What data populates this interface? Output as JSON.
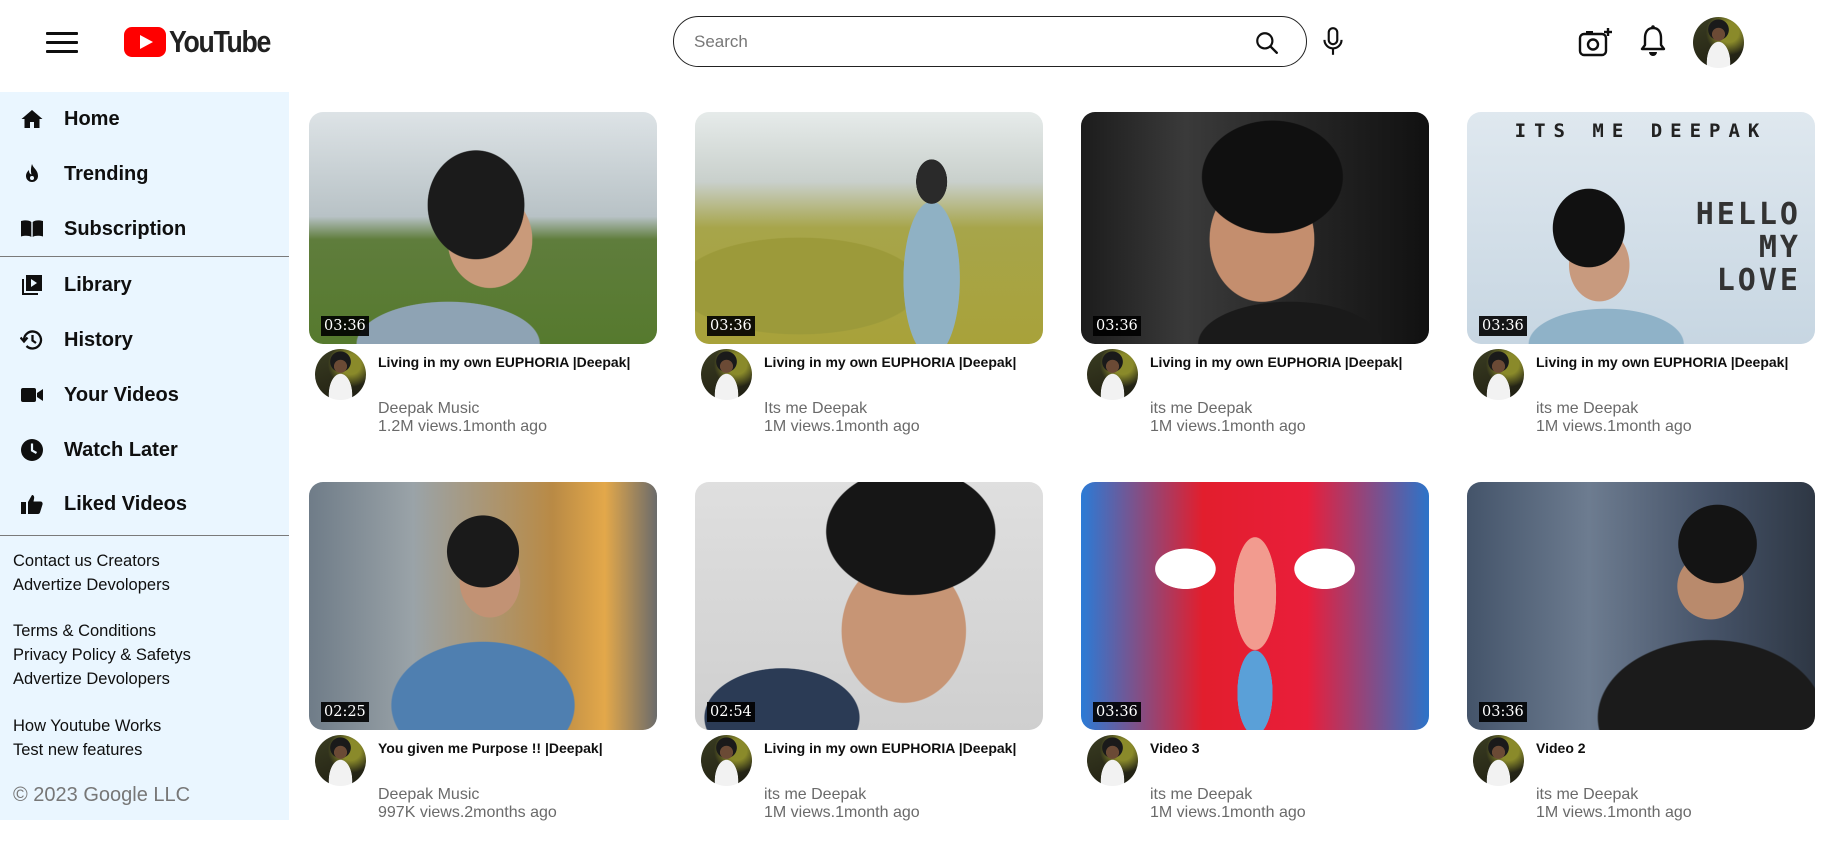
{
  "header": {
    "logo_text": "YouTube",
    "search_placeholder": "Search"
  },
  "sidebar": {
    "items": [
      {
        "label": "Home",
        "icon": "home-icon"
      },
      {
        "label": "Trending",
        "icon": "fire-icon"
      },
      {
        "label": "Subscription",
        "icon": "book-icon"
      },
      {
        "label": "Library",
        "icon": "library-icon"
      },
      {
        "label": "History",
        "icon": "history-icon"
      },
      {
        "label": "Your Videos",
        "icon": "video-camera-icon"
      },
      {
        "label": "Watch Later",
        "icon": "clock-icon"
      },
      {
        "label": "Liked Videos",
        "icon": "thumbs-up-icon"
      }
    ],
    "footer": {
      "line1": [
        "Contact us",
        "Creators"
      ],
      "line2": [
        "Advertize",
        "Devolopers"
      ],
      "line3": "Terms & Conditions",
      "line4": "Privacy Policy & Safetys",
      "line5": [
        "Advertize",
        "Devolopers"
      ],
      "line6": "How Youtube Works",
      "line7": "Test new features",
      "copyright": "© 2023 Google LLC"
    }
  },
  "videos": [
    {
      "title": "Living in my own EUPHORIA |Deepak|",
      "channel": "Deepak Music",
      "meta": "1.2M views.1month ago",
      "duration": "03:36"
    },
    {
      "title": "Living in my own EUPHORIA |Deepak|",
      "channel": "Its me Deepak",
      "meta": "1M views.1month ago",
      "duration": "03:36"
    },
    {
      "title": "Living in my own EUPHORIA |Deepak|",
      "channel": "its me Deepak",
      "meta": "1M views.1month ago",
      "duration": "03:36"
    },
    {
      "title": "Living in my own EUPHORIA |Deepak|",
      "channel": "its me Deepak",
      "meta": "1M views.1month ago",
      "duration": "03:36",
      "overlay_top": "ITS ME DEEPAK",
      "overlay_right": [
        "HELLO",
        "MY",
        "LOVE"
      ]
    },
    {
      "title": "You given me Purpose !! |Deepak|",
      "channel": "Deepak Music",
      "meta": "997K views.2months ago",
      "duration": "02:25"
    },
    {
      "title": "Living in my own EUPHORIA |Deepak|",
      "channel": "its me Deepak",
      "meta": "1M views.1month ago",
      "duration": "02:54"
    },
    {
      "title": "Video 3",
      "channel": "its me Deepak",
      "meta": "1M views.1month ago",
      "duration": "03:36"
    },
    {
      "title": "Video 2",
      "channel": "its me Deepak",
      "meta": "1M views.1month ago",
      "duration": "03:36"
    }
  ],
  "colors": {
    "brand_red": "#ff0000",
    "sidebar_bg": "#eaf6ff",
    "muted_text": "#6a6a6a"
  }
}
